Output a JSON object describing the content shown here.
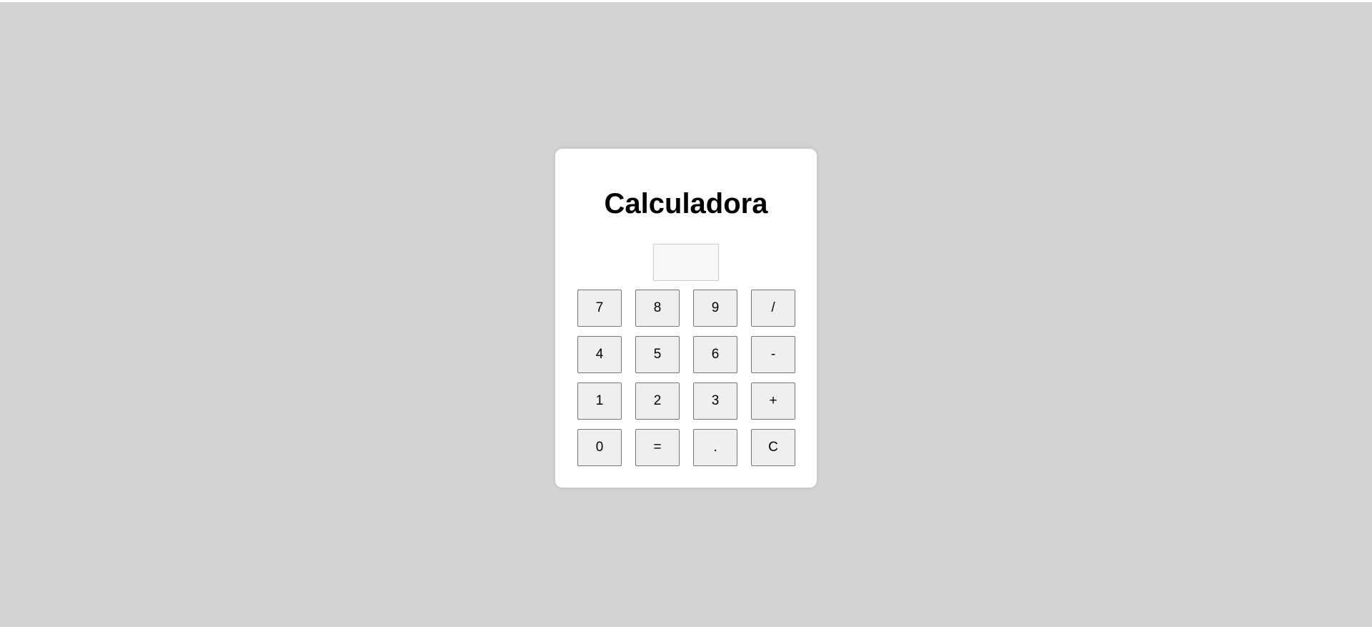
{
  "calculator": {
    "title": "Calculadora",
    "display_value": "",
    "keys": [
      {
        "label": "7",
        "name": "key-7"
      },
      {
        "label": "8",
        "name": "key-8"
      },
      {
        "label": "9",
        "name": "key-9"
      },
      {
        "label": "/",
        "name": "divide-button"
      },
      {
        "label": "4",
        "name": "key-4"
      },
      {
        "label": "5",
        "name": "key-5"
      },
      {
        "label": "6",
        "name": "key-6"
      },
      {
        "label": "-",
        "name": "subtract-button"
      },
      {
        "label": "1",
        "name": "key-1"
      },
      {
        "label": "2",
        "name": "key-2"
      },
      {
        "label": "3",
        "name": "key-3"
      },
      {
        "label": "+",
        "name": "add-button"
      },
      {
        "label": "0",
        "name": "key-0"
      },
      {
        "label": "=",
        "name": "equals-button"
      },
      {
        "label": ".",
        "name": "decimal-button"
      },
      {
        "label": "C",
        "name": "clear-button"
      }
    ]
  },
  "colors": {
    "page_background": "#d3d3d3",
    "card_background": "#ffffff",
    "key_background": "#efefef",
    "key_border": "#767676",
    "display_background": "#f8f8f8"
  }
}
